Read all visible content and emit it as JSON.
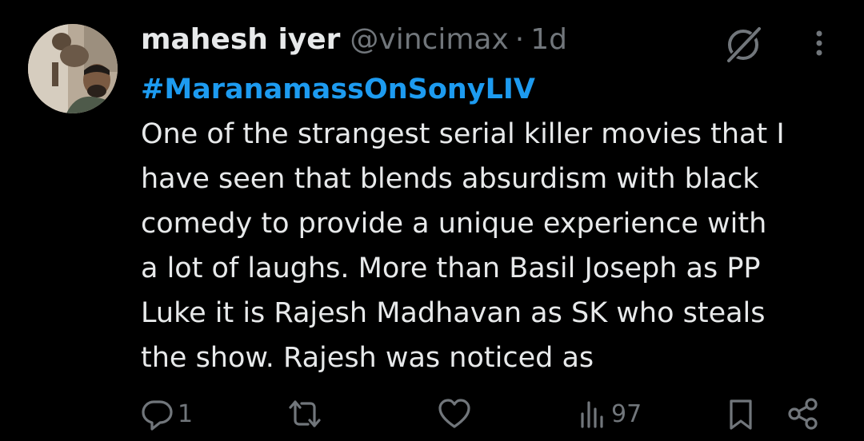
{
  "colors": {
    "background": "#000000",
    "text": "#e7e9ea",
    "muted": "#71767b",
    "link": "#1d9bf0"
  },
  "author": {
    "name": "mahesh iyer",
    "handle": "@vincimax",
    "separator": "·",
    "time": "1d",
    "avatar": "avatar-photo"
  },
  "header_icons": [
    "grok-icon",
    "more-vertical-icon"
  ],
  "post": {
    "hashtag": "#MaranamassOnSonyLIV",
    "lines": [
      "One of the strangest serial killer movies that I",
      "have seen that blends absurdism with black",
      "comedy to provide a unique experience with",
      "a lot of laughs. More than Basil Joseph as PP",
      "Luke it is Rajesh Madhavan as SK who steals",
      "the show. Rajesh was noticed as"
    ]
  },
  "actions": {
    "reply": {
      "icon": "reply-icon",
      "count": "1"
    },
    "repost": {
      "icon": "repost-icon",
      "count": ""
    },
    "like": {
      "icon": "like-icon",
      "count": ""
    },
    "views": {
      "icon": "views-icon",
      "count": "97"
    },
    "bookmark": {
      "icon": "bookmark-icon"
    },
    "share": {
      "icon": "share-icon"
    }
  }
}
